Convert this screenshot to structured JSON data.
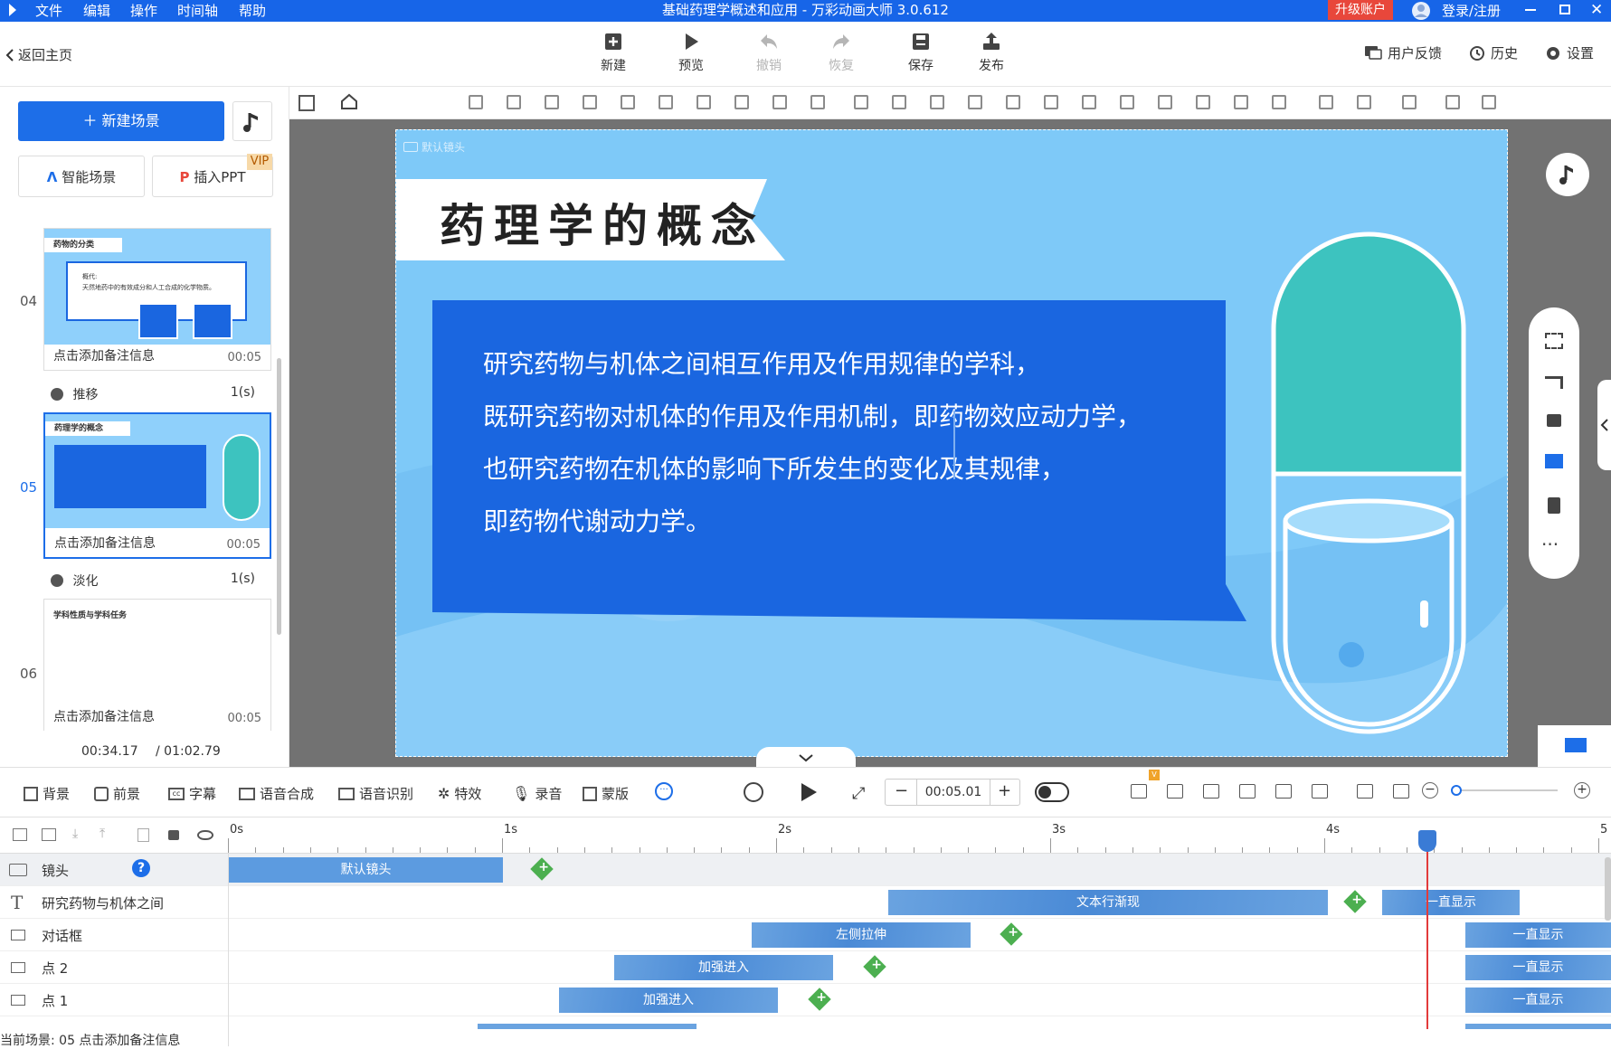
{
  "titlebar": {
    "menu": [
      "文件",
      "编辑",
      "操作",
      "时间轴",
      "帮助"
    ],
    "title": "基础药理学概述和应用 - 万彩动画大师 3.0.612",
    "upgrade": "升级账户",
    "login": "登录/注册"
  },
  "toolbar": {
    "back": "返回主页",
    "buttons": [
      {
        "label": "新建",
        "icon": "plus-square-icon",
        "disabled": false
      },
      {
        "label": "预览",
        "icon": "play-icon",
        "disabled": false
      },
      {
        "label": "撤销",
        "icon": "undo-icon",
        "disabled": true
      },
      {
        "label": "恢复",
        "icon": "redo-icon",
        "disabled": true
      },
      {
        "label": "保存",
        "icon": "save-icon",
        "disabled": false
      },
      {
        "label": "发布",
        "icon": "publish-icon",
        "disabled": false
      }
    ],
    "feedback": "用户反馈",
    "history": "历史",
    "settings": "设置"
  },
  "left": {
    "new_scene": "＋ 新建场景",
    "smart_scene": "智能场景",
    "insert_ppt": "插入PPT",
    "vip": "VIP",
    "scenes": [
      {
        "num": "04",
        "title": "药物的分类",
        "note": "点击添加备注信息",
        "dur": "00:05",
        "body1": "概代:",
        "body2": "天然地药中的有效成分和人工合成的化学物质。"
      },
      {
        "num": "05",
        "title": "药理学的概念",
        "note": "点击添加备注信息",
        "dur": "00:05"
      },
      {
        "num": "06",
        "title": "学科性质与学科任务",
        "note": "点击添加备注信息",
        "dur": "00:05"
      }
    ],
    "transitions": [
      {
        "label": "推移",
        "dur": "1(s)"
      },
      {
        "label": "淡化",
        "dur": "1(s)"
      }
    ],
    "time_current": "00:34.17",
    "time_total": "/ 01:02.79"
  },
  "slide": {
    "camera_label": "默认镜头",
    "title": "药理学的概念",
    "lines": [
      "研究药物与机体之间相互作用及作用规律的学科，",
      "既研究药物对机体的作用及作用机制，即药物效应动力学，",
      "也研究药物在机体的影响下所发生的变化及其规律，",
      "即药物代谢动力学。"
    ]
  },
  "bottom": {
    "items": [
      "背景",
      "前景",
      "字幕",
      "语音合成",
      "语音识别",
      "特效",
      "录音",
      "蒙版"
    ],
    "time_value": "00:05.01"
  },
  "timeline": {
    "ruler": [
      "0s",
      "1s",
      "2s",
      "3s",
      "4s",
      "5"
    ],
    "tracks": [
      {
        "name": "镜头",
        "icon": "camera-icon",
        "clips": [
          {
            "label": "默认镜头"
          }
        ]
      },
      {
        "name": "研究药物与机体之间",
        "icon": "text-icon",
        "clips": [
          {
            "label": "文本行渐现"
          },
          {
            "label": "一直显示"
          }
        ]
      },
      {
        "name": "对话框",
        "icon": "image-icon",
        "clips": [
          {
            "label": "左侧拉伸"
          },
          {
            "label": "一直显示"
          }
        ]
      },
      {
        "name": "点 2",
        "icon": "image-icon",
        "clips": [
          {
            "label": "加强进入"
          },
          {
            "label": "一直显示"
          }
        ]
      },
      {
        "name": "点 1",
        "icon": "image-icon",
        "clips": [
          {
            "label": "加强进入"
          },
          {
            "label": "一直显示"
          }
        ]
      }
    ],
    "help": "?"
  },
  "status": {
    "text": "当前场景: 05   点击添加备注信息"
  },
  "colors": {
    "accent": "#1d6ee8",
    "titlebar": "#1765e8",
    "slide_bg": "#7ec9f8",
    "slide_box": "#1a66e0",
    "teal": "#3dc3bf"
  }
}
